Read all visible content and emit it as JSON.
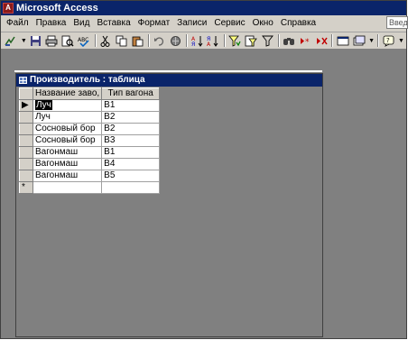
{
  "window": {
    "title": "Microsoft Access",
    "app_icon_glyph": "A",
    "help_box_text": "Введи"
  },
  "menu": [
    "Файл",
    "Правка",
    "Вид",
    "Вставка",
    "Формат",
    "Записи",
    "Сервис",
    "Окно",
    "Справка"
  ],
  "toolbar_icons": [
    "view-design-icon",
    "save-icon",
    "print-icon",
    "print-preview-icon",
    "spelling-icon",
    "cut-icon",
    "copy-icon",
    "paste-icon",
    "undo-icon",
    "hyperlink-icon",
    "sort-ascending-icon",
    "sort-descending-icon",
    "filter-by-selection-icon",
    "filter-by-form-icon",
    "apply-filter-icon",
    "find-icon",
    "new-record-icon",
    "delete-record-icon",
    "database-window-icon",
    "new-object-icon",
    "help-icon"
  ],
  "table_window": {
    "title": "Производитель : таблица",
    "columns": [
      "Название заво,",
      "Тип вагона"
    ],
    "rows": [
      {
        "selector": "▶",
        "name": "Луч",
        "type": "B1"
      },
      {
        "selector": "",
        "name": "Луч",
        "type": "B2"
      },
      {
        "selector": "",
        "name": "Сосновый бор",
        "type": "B2"
      },
      {
        "selector": "",
        "name": "Сосновый бор",
        "type": "B3"
      },
      {
        "selector": "",
        "name": "Вагонмаш",
        "type": "B1"
      },
      {
        "selector": "",
        "name": "Вагонмаш",
        "type": "B4"
      },
      {
        "selector": "",
        "name": "Вагонмаш",
        "type": "B5"
      }
    ],
    "new_row_selector": "*"
  },
  "colors": {
    "title_bar": "#0a246a",
    "chrome": "#d4d0c8",
    "workspace": "#808080"
  }
}
